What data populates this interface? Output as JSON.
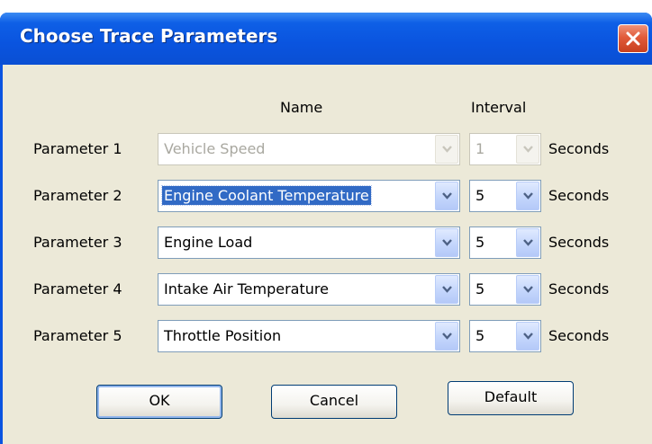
{
  "dialog": {
    "title": "Choose Trace Parameters"
  },
  "columns": {
    "name": "Name",
    "interval": "Interval"
  },
  "rows": [
    {
      "label": "Parameter 1",
      "name": "Vehicle Speed",
      "interval": "1",
      "unit": "Seconds",
      "enabled": false
    },
    {
      "label": "Parameter 2",
      "name": "Engine Coolant Temperature",
      "interval": "5",
      "unit": "Seconds",
      "enabled": true,
      "selected": true
    },
    {
      "label": "Parameter 3",
      "name": "Engine Load",
      "interval": "5",
      "unit": "Seconds",
      "enabled": true
    },
    {
      "label": "Parameter 4",
      "name": "Intake Air Temperature",
      "interval": "5",
      "unit": "Seconds",
      "enabled": true
    },
    {
      "label": "Parameter 5",
      "name": "Throttle Position",
      "interval": "5",
      "unit": "Seconds",
      "enabled": true
    }
  ],
  "buttons": {
    "ok": "OK",
    "cancel": "Cancel",
    "default": "Default"
  },
  "colors": {
    "titlebar": "#0a54e1",
    "client": "#ece9d8",
    "selection": "#316ac5",
    "close_button": "#e15b3a"
  },
  "icons": {
    "close": "close-icon",
    "dropdown": "chevron-down-icon"
  }
}
